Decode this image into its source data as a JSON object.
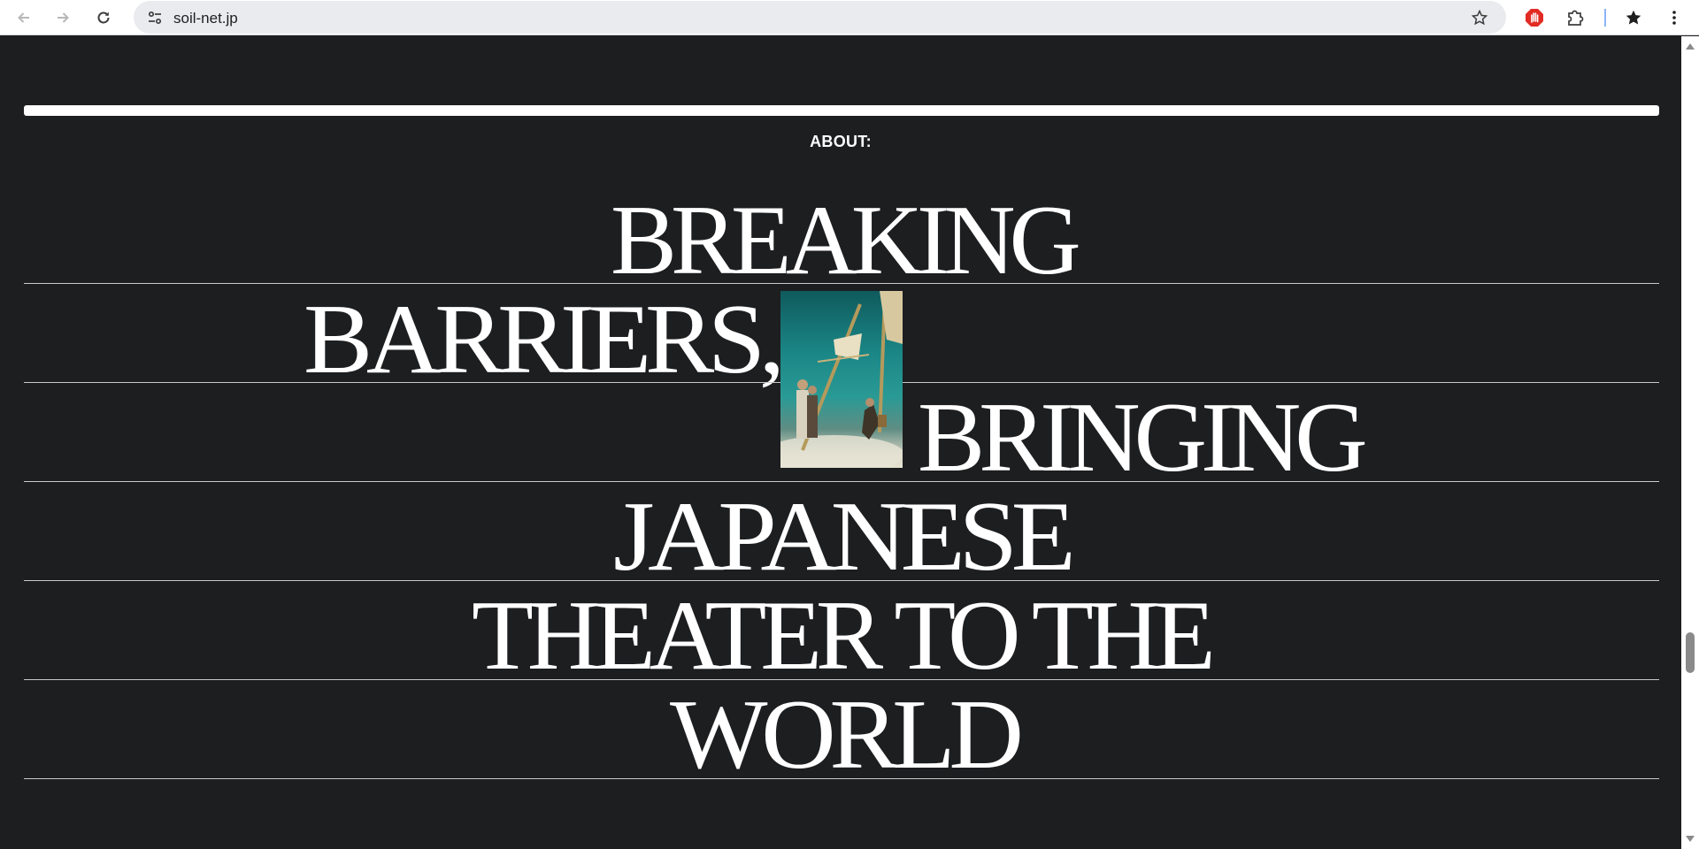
{
  "browser": {
    "url": "soil-net.jp",
    "icons": {
      "back": "arrow-left-icon",
      "forward": "arrow-right-icon",
      "reload": "reload-icon",
      "site_info": "tune-icon",
      "bookmark": "star-outline-icon",
      "ext_adblock": "stop-hand-icon",
      "extensions": "puzzle-icon",
      "bookmarks": "star-filled-icon",
      "menu": "kebab-menu-icon"
    }
  },
  "page": {
    "section_label": "ABOUT:",
    "headline_lines": [
      "BREAKING",
      "BARRIERS,",
      "BRINGING",
      "JAPANESE",
      "THEATER TO THE",
      "WORLD"
    ],
    "colors": {
      "background": "#1d1e20",
      "text": "#ffffff",
      "rule": "#c9c9c9"
    }
  }
}
